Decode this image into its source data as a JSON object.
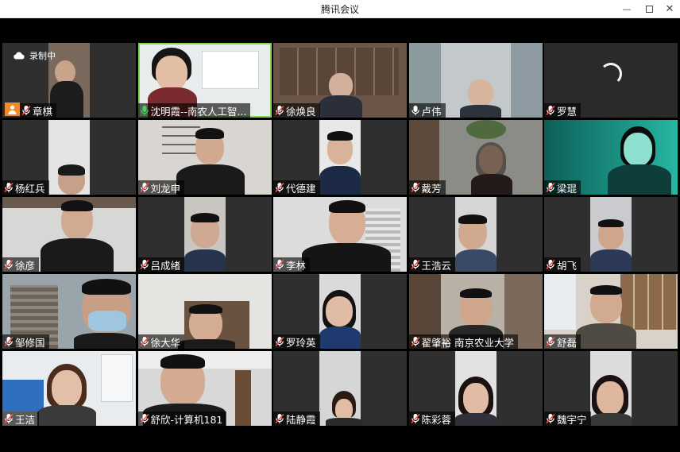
{
  "window": {
    "title": "腾讯会议",
    "minimize_label": "—",
    "close_label": "✕"
  },
  "recording": {
    "label": "录制中"
  },
  "colors": {
    "active_speaker": "#7ed957",
    "nameplate_bg": "#000000",
    "avatar_badge": "#f0892b"
  },
  "participants": [
    {
      "name": "章棋",
      "mic": "muted"
    },
    {
      "name": "沈明霞--南农人工智...",
      "mic": "speaking"
    },
    {
      "name": "徐焕良",
      "mic": "muted"
    },
    {
      "name": "卢伟",
      "mic": "on"
    },
    {
      "name": "罗慧",
      "mic": "muted"
    },
    {
      "name": "杨红兵",
      "mic": "muted"
    },
    {
      "name": "刘龙申",
      "mic": "muted"
    },
    {
      "name": "代德建",
      "mic": "muted"
    },
    {
      "name": "戴芳",
      "mic": "muted"
    },
    {
      "name": "梁琨",
      "mic": "muted"
    },
    {
      "name": "徐彦",
      "mic": "muted"
    },
    {
      "name": "吕成绪",
      "mic": "muted"
    },
    {
      "name": "李林",
      "mic": "muted"
    },
    {
      "name": "王浩云",
      "mic": "muted"
    },
    {
      "name": "胡飞",
      "mic": "muted"
    },
    {
      "name": "邹修国",
      "mic": "muted"
    },
    {
      "name": "徐大华",
      "mic": "muted"
    },
    {
      "name": "罗玲英",
      "mic": "muted"
    },
    {
      "name": "翟肇裕 南京农业大学",
      "mic": "muted"
    },
    {
      "name": "舒磊",
      "mic": "muted"
    },
    {
      "name": "王洁",
      "mic": "muted"
    },
    {
      "name": "舒欣-计算机181",
      "mic": "muted"
    },
    {
      "name": "陆静霞",
      "mic": "muted"
    },
    {
      "name": "陈彩蓉",
      "mic": "muted"
    },
    {
      "name": "魏宇宁",
      "mic": "muted"
    }
  ]
}
